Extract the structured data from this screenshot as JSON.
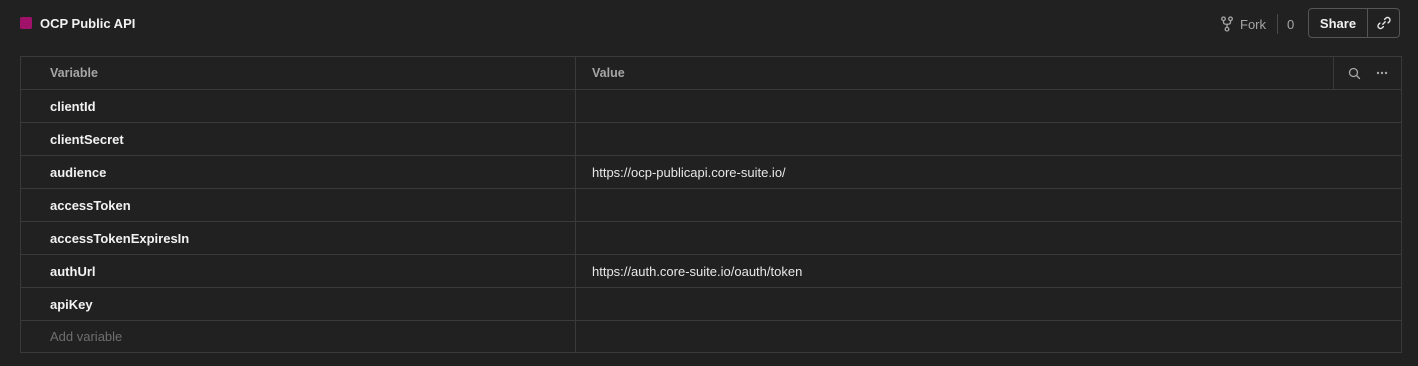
{
  "header": {
    "title": "OCP Public API",
    "env_color": "#a0126a",
    "fork_label": "Fork",
    "fork_count": "0",
    "share_label": "Share"
  },
  "table": {
    "columns": {
      "variable": "Variable",
      "value": "Value"
    },
    "rows": [
      {
        "name": "clientId",
        "value": ""
      },
      {
        "name": "clientSecret",
        "value": ""
      },
      {
        "name": "audience",
        "value": "https://ocp-publicapi.core-suite.io/"
      },
      {
        "name": "accessToken",
        "value": ""
      },
      {
        "name": "accessTokenExpiresIn",
        "value": ""
      },
      {
        "name": "authUrl",
        "value": "https://auth.core-suite.io/oauth/token"
      },
      {
        "name": "apiKey",
        "value": ""
      }
    ],
    "add_placeholder": "Add variable"
  }
}
